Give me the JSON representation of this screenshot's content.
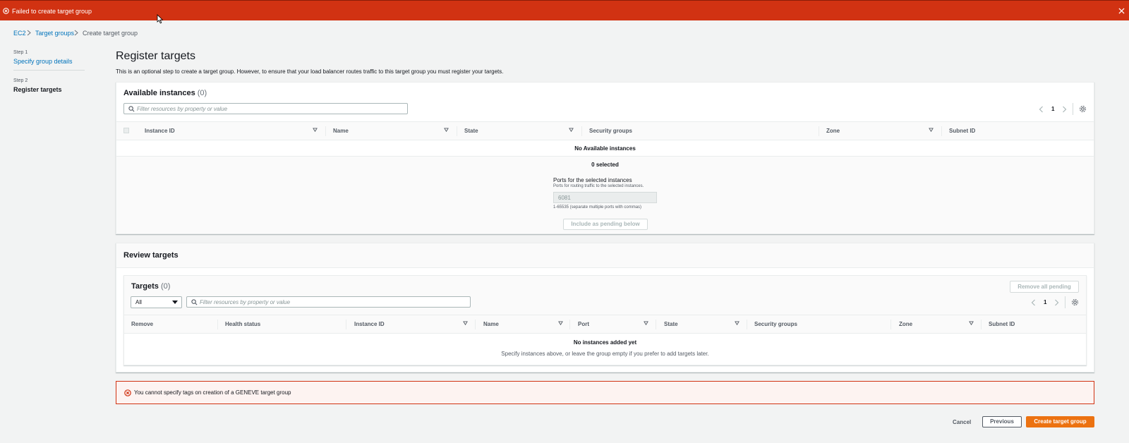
{
  "flash": {
    "message": "Failed to create target group",
    "icon": "error-icon",
    "close_icon": "close-icon",
    "color": "#d13212"
  },
  "breadcrumb": {
    "items": [
      "EC2",
      "Target groups",
      "Create target group"
    ]
  },
  "steps": [
    {
      "label": "Step 1",
      "title": "Specify group details"
    },
    {
      "label": "Step 2",
      "title": "Register targets"
    }
  ],
  "page": {
    "title": "Register targets",
    "description": "This is an optional step to create a target group. However, to ensure that your load balancer routes traffic to this target group you must register your targets."
  },
  "available": {
    "title": "Available instances",
    "count": "(0)",
    "search_placeholder": "Filter resources by property or value",
    "page_number": "1",
    "columns": [
      "Instance ID",
      "Name",
      "State",
      "Security groups",
      "Zone",
      "Subnet ID"
    ],
    "empty_text": "No Available instances",
    "selected_text": "0 selected",
    "ports_label": "Ports for the selected instances",
    "ports_desc": "Ports for routing traffic to the selected instances.",
    "port_value": "6081",
    "ports_hint": "1-65535 (separate multiple ports with commas)",
    "include_button": "Include as pending below"
  },
  "review": {
    "title": "Review targets",
    "targets_title": "Targets",
    "targets_count": "(0)",
    "remove_all_button": "Remove all pending",
    "filter_selected": "All",
    "search_placeholder": "Filter resources by property or value",
    "page_number": "1",
    "columns": [
      "Remove",
      "Health status",
      "Instance ID",
      "Name",
      "Port",
      "State",
      "Security groups",
      "Zone",
      "Subnet ID"
    ],
    "empty_title": "No instances added yet",
    "empty_desc": "Specify instances above, or leave the group empty if you prefer to add targets later."
  },
  "error_alert": {
    "message": "You cannot specify tags on creation of a GENEVE target group"
  },
  "footer": {
    "cancel": "Cancel",
    "previous": "Previous",
    "create": "Create target group"
  },
  "colors": {
    "link": "#0073bb",
    "primary": "#ec7211",
    "error": "#d13212"
  }
}
